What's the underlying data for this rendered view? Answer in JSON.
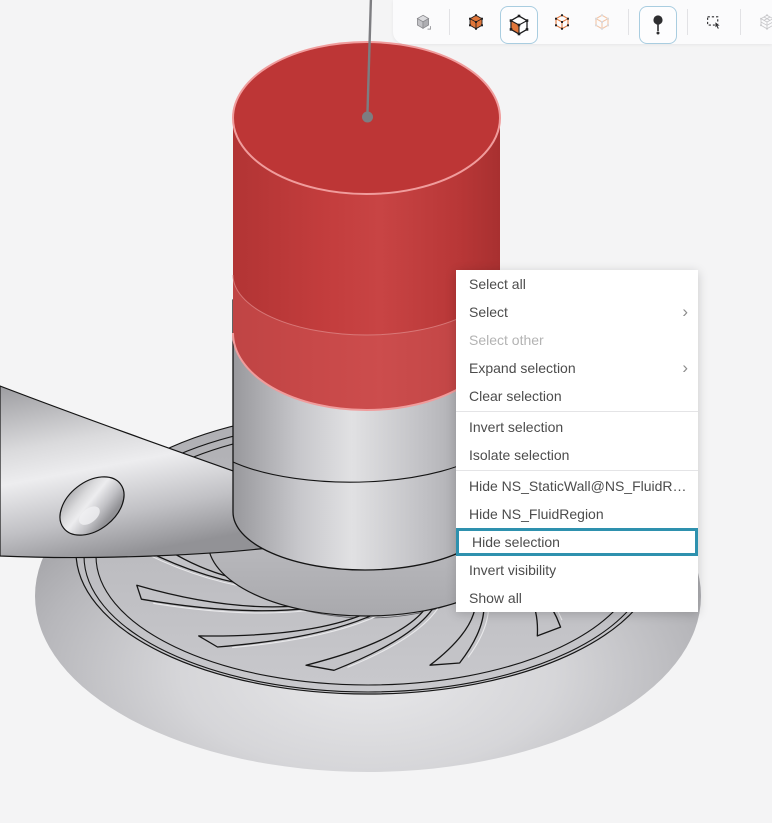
{
  "toolbar": {
    "icons": [
      {
        "name": "selection-mode-cube",
        "state": "normal"
      },
      {
        "name": "volume-select",
        "state": "normal"
      },
      {
        "name": "face-select",
        "state": "selected"
      },
      {
        "name": "edge-select",
        "state": "normal"
      },
      {
        "name": "vertex-select",
        "state": "disabled"
      },
      {
        "name": "pick-point-pin",
        "state": "selected"
      },
      {
        "name": "box-select",
        "state": "normal"
      },
      {
        "name": "mesh-display",
        "state": "disabled"
      },
      {
        "name": "measure-tool",
        "state": "normal"
      }
    ]
  },
  "context_menu": {
    "submenu_arrow": "›",
    "items": [
      {
        "label": "Select all"
      },
      {
        "label": "Select",
        "submenu": true
      },
      {
        "label": "Select other",
        "disabled": true
      },
      {
        "label": "Expand selection",
        "submenu": true
      },
      {
        "label": "Clear selection"
      },
      {
        "divider": true
      },
      {
        "label": "Invert selection"
      },
      {
        "label": "Isolate selection"
      },
      {
        "divider": true
      },
      {
        "label": "Hide NS_StaticWall@NS_FluidRegion"
      },
      {
        "label": "Hide NS_FluidRegion"
      },
      {
        "label": "Hide selection",
        "highlighted": true
      },
      {
        "label": "Invert visibility"
      },
      {
        "label": "Show all"
      }
    ]
  },
  "scene": {
    "selected_part": "cylindrical boundary (red highlighted selection)",
    "colors": {
      "selection_red": "#c23c3c",
      "selection_rim_pink": "#f09c9c",
      "model_gray": "#c6c6ca",
      "edge_black": "#161616",
      "highlight_teal": "#2e91ae",
      "icon_orange": "#e0763a",
      "axis_gray": "#7d7d81",
      "background": "#f4f4f5"
    }
  }
}
